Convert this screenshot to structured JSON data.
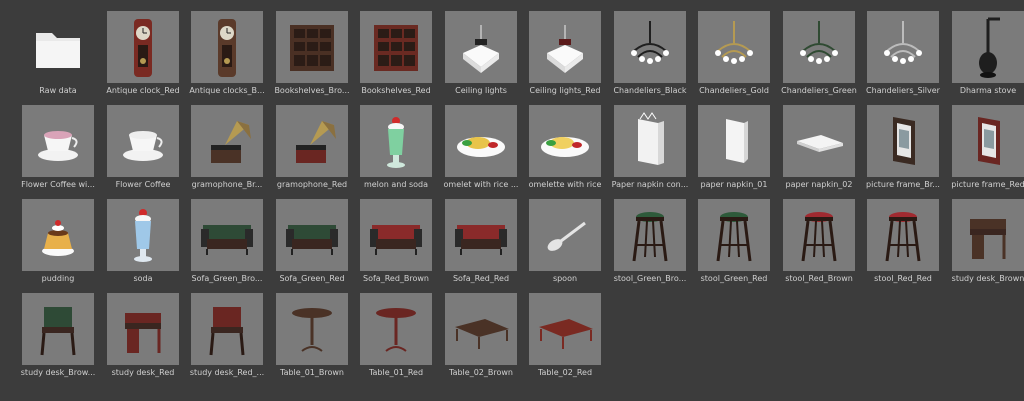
{
  "items": [
    {
      "label": "Raw data",
      "icon": "folder-icon",
      "folder": true
    },
    {
      "label": "Antique clock_Red",
      "icon": "antique-clock-icon",
      "color": "#7a2a22"
    },
    {
      "label": "Antique clocks_B...",
      "icon": "antique-clock-icon",
      "color": "#5a3a2a"
    },
    {
      "label": "Bookshelves_Bro...",
      "icon": "bookshelf-icon",
      "color": "#4a3024"
    },
    {
      "label": "Bookshelves_Red",
      "icon": "bookshelf-icon",
      "color": "#6a2a22"
    },
    {
      "label": "Ceiling lights",
      "icon": "ceiling-light-icon",
      "color": "#222222"
    },
    {
      "label": "Ceiling lights_Red",
      "icon": "ceiling-light-icon",
      "color": "#5a1a1a"
    },
    {
      "label": "Chandeliers_Black",
      "icon": "chandelier-icon",
      "color": "#1f1f1f"
    },
    {
      "label": "Chandeliers_Gold",
      "icon": "chandelier-icon",
      "color": "#b59a52"
    },
    {
      "label": "Chandeliers_Green",
      "icon": "chandelier-icon",
      "color": "#2f4a32"
    },
    {
      "label": "Chandeliers_Silver",
      "icon": "chandelier-icon",
      "color": "#bcbcbc"
    },
    {
      "label": "Dharma stove",
      "icon": "stove-icon",
      "color": "#1e1e1e"
    },
    {
      "label": "Flower Coffee wi...",
      "icon": "coffee-cup-icon",
      "color": "#d9a3b8"
    },
    {
      "label": "Flower Coffee",
      "icon": "coffee-cup-icon",
      "color": "#eeeeee"
    },
    {
      "label": "gramophone_Br...",
      "icon": "gramophone-icon",
      "color": "#4a3226"
    },
    {
      "label": "gramophone_Red",
      "icon": "gramophone-icon",
      "color": "#6a2622"
    },
    {
      "label": "melon and soda",
      "icon": "melon-soda-icon",
      "color": "#7fd0a0"
    },
    {
      "label": "omelet with rice ...",
      "icon": "omelet-icon",
      "color": "#e8c44a"
    },
    {
      "label": "omelette with rice",
      "icon": "omelet-icon",
      "color": "#f0d060"
    },
    {
      "label": "Paper napkin con...",
      "icon": "napkin-holder-icon",
      "color": "#f2f2f2"
    },
    {
      "label": "paper napkin_01",
      "icon": "paper-napkin-icon",
      "color": "#f4f4f4"
    },
    {
      "label": "paper napkin_02",
      "icon": "paper-napkin-flat-icon",
      "color": "#f4f4f4"
    },
    {
      "label": "picture frame_Br...",
      "icon": "picture-frame-icon",
      "color": "#3a2a22"
    },
    {
      "label": "picture frame_Red",
      "icon": "picture-frame-icon",
      "color": "#6a2622"
    },
    {
      "label": "pudding",
      "icon": "pudding-icon",
      "color": "#e8b04a"
    },
    {
      "label": "soda",
      "icon": "soda-icon",
      "color": "#9fc8e8"
    },
    {
      "label": "Sofa_Green_Bro...",
      "icon": "sofa-icon",
      "color": "#2e4a36"
    },
    {
      "label": "Sofa_Green_Red",
      "icon": "sofa-icon",
      "color": "#2e4a36"
    },
    {
      "label": "Sofa_Red_Brown",
      "icon": "sofa-icon",
      "color": "#8a2a2a"
    },
    {
      "label": "Sofa_Red_Red",
      "icon": "sofa-icon",
      "color": "#8a2a2a"
    },
    {
      "label": "spoon",
      "icon": "spoon-icon",
      "color": "#e4e4e4"
    },
    {
      "label": "stool_Green_Bro...",
      "icon": "stool-icon",
      "color": "#2e5a3a"
    },
    {
      "label": "stool_Green_Red",
      "icon": "stool-icon",
      "color": "#2e5a3a"
    },
    {
      "label": "stool_Red_Brown",
      "icon": "stool-icon",
      "color": "#a02a30"
    },
    {
      "label": "stool_Red_Red",
      "icon": "stool-icon",
      "color": "#a02a30"
    },
    {
      "label": "study desk_Brown",
      "icon": "study-desk-icon",
      "color": "#4a3226"
    },
    {
      "label": "study desk_Brow...",
      "icon": "study-chair-icon",
      "color": "#2e4a36"
    },
    {
      "label": "study desk_Red",
      "icon": "study-desk-icon",
      "color": "#6a2622"
    },
    {
      "label": "study desk_Red_...",
      "icon": "study-chair-icon",
      "color": "#6a2622"
    },
    {
      "label": "Table_01_Brown",
      "icon": "round-table-icon",
      "color": "#4a3226"
    },
    {
      "label": "Table_01_Red",
      "icon": "round-table-icon",
      "color": "#6a2622"
    },
    {
      "label": "Table_02_Brown",
      "icon": "low-table-icon",
      "color": "#4a3226"
    },
    {
      "label": "Table_02_Red",
      "icon": "low-table-icon",
      "color": "#7a2a22"
    }
  ]
}
